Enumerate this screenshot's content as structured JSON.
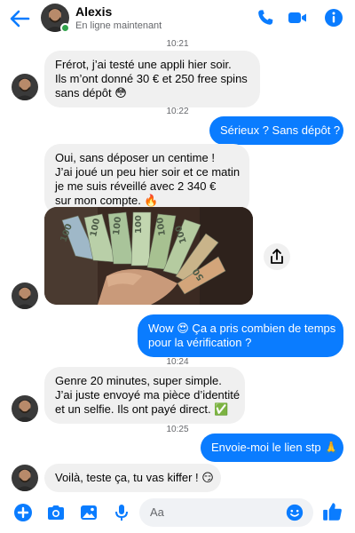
{
  "header": {
    "name": "Alexis",
    "status": "En ligne maintenant",
    "icons": [
      "back-arrow-icon",
      "phone-icon",
      "video-camera-icon",
      "info-icon"
    ]
  },
  "conversation": {
    "time_1": "10:21",
    "msg_1": [
      "Frérot, j’ai testé une appli hier soir.",
      "Ils m’ont donné 30 € et 250 free spins",
      "sans dépôt 😳"
    ],
    "time_2": "10:22",
    "msg_2": "Sérieux ? Sans dépôt ?",
    "msg_3": [
      "Oui, sans déposer un centime !",
      "J’ai joué un peu hier soir et ce matin",
      "je me suis réveillé avec 2 340 €",
      "sur mon compte. 🔥"
    ],
    "msg_4": [
      "Wow 😍 Ça a pris combien de temps",
      "pour la vérification ?"
    ],
    "time_3": "10:24",
    "msg_5": [
      "Genre 20 minutes, super simple.",
      "J’ai juste envoyé ma pièce d’identité",
      "et un selfie. Ils ont payé direct. ✅"
    ],
    "time_4": "10:25",
    "msg_6": "Envoie-moi le lien stp 🙏",
    "msg_7": "Voilà, teste ça, tu vas kiffer ! 😏"
  },
  "composer": {
    "placeholder": "Aa",
    "icons": [
      "plus-icon",
      "camera-icon",
      "gallery-icon",
      "microphone-icon",
      "emoji-icon",
      "thumbs-up-icon"
    ]
  },
  "colors": {
    "accent": "#0a7cff",
    "received_bubble": "#f0f0f0",
    "online": "#31a24c"
  }
}
